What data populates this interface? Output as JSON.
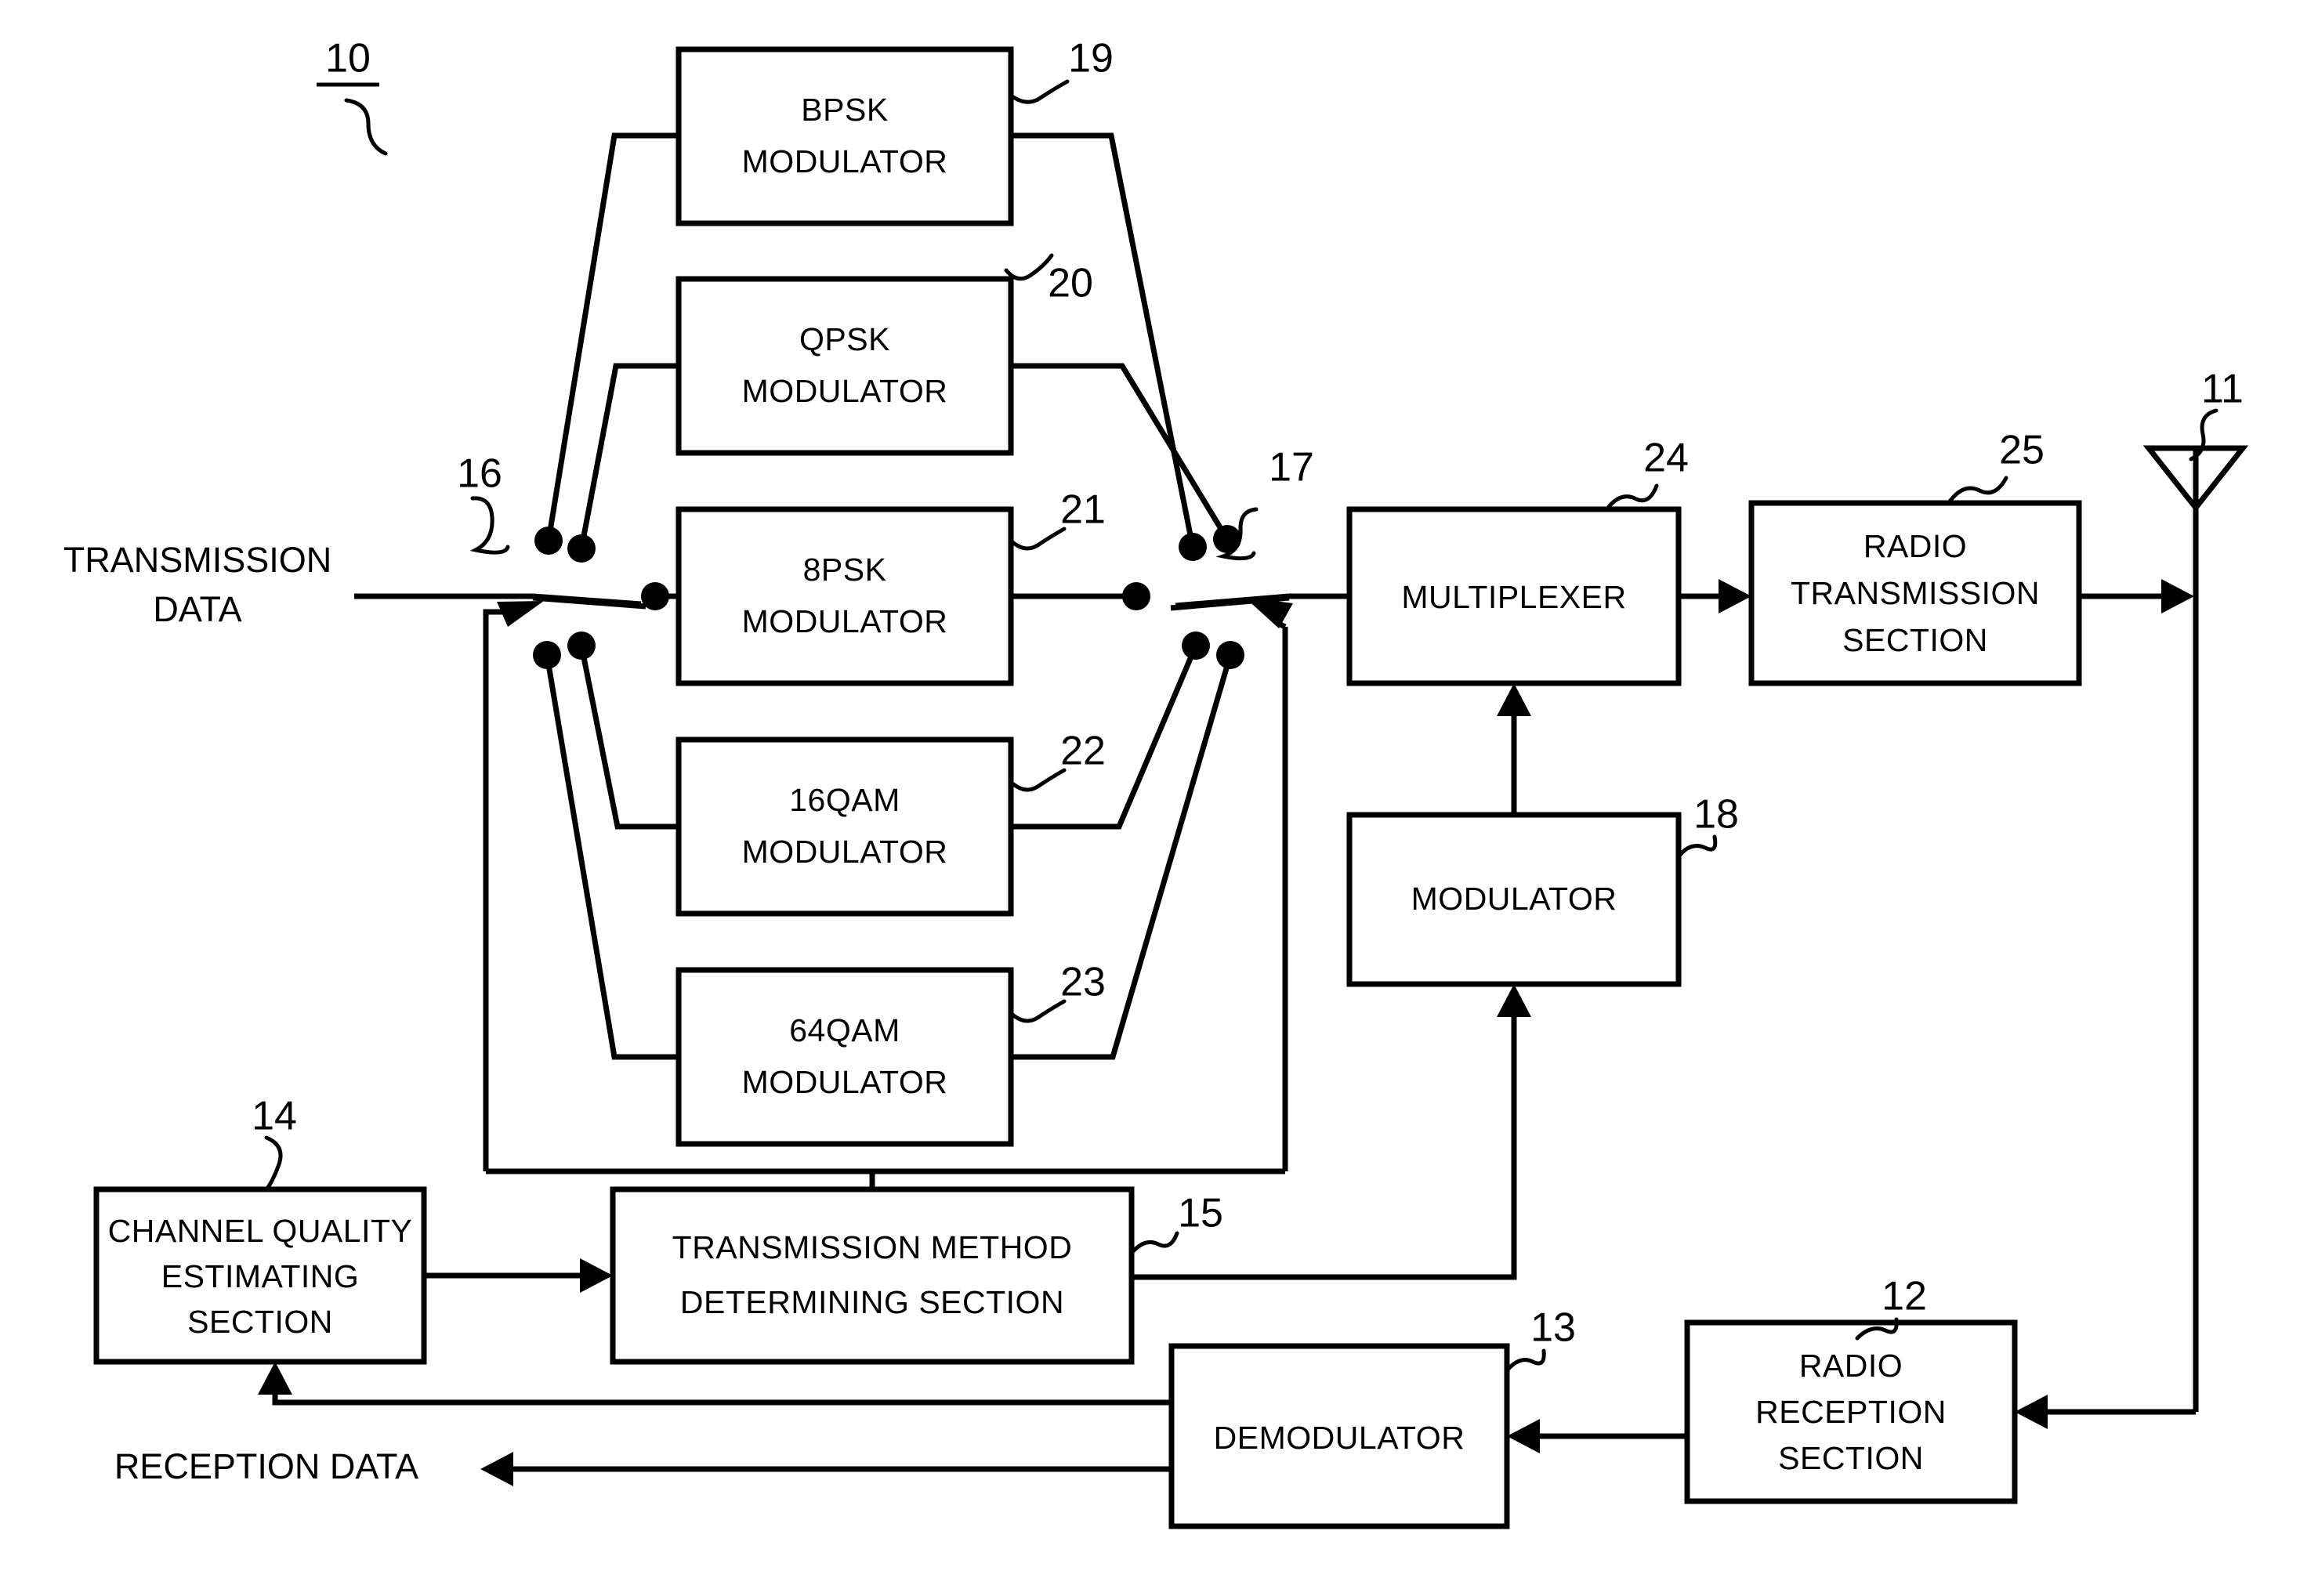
{
  "figure": {
    "system_ref": "10",
    "background_color": "#ffffff",
    "line_color": "#000000"
  },
  "io_labels": {
    "transmission_data_line1": "TRANSMISSION",
    "transmission_data_line2": "DATA",
    "reception_data": "RECEPTION DATA"
  },
  "blocks": [
    {
      "id": "bpsk",
      "ref": "19",
      "line1": "BPSK",
      "line2": "MODULATOR"
    },
    {
      "id": "qpsk",
      "ref": "20",
      "line1": "QPSK",
      "line2": "MODULATOR"
    },
    {
      "id": "psk8",
      "ref": "21",
      "line1": "8PSK",
      "line2": "MODULATOR"
    },
    {
      "id": "qam16",
      "ref": "22",
      "line1": "16QAM",
      "line2": "MODULATOR"
    },
    {
      "id": "qam64",
      "ref": "23",
      "line1": "64QAM",
      "line2": "MODULATOR"
    },
    {
      "id": "multiplexer",
      "ref": "24",
      "line1": "MULTIPLEXER",
      "line2": ""
    },
    {
      "id": "radio_tx",
      "ref": "25",
      "line1": "RADIO",
      "line2": "TRANSMISSION",
      "line3": "SECTION"
    },
    {
      "id": "modulator",
      "ref": "18",
      "line1": "MODULATOR",
      "line2": ""
    },
    {
      "id": "chan_qual",
      "ref": "14",
      "line1": "CHANNEL QUALITY",
      "line2": "ESTIMATING",
      "line3": "SECTION"
    },
    {
      "id": "tx_method",
      "ref": "15",
      "line1": "TRANSMISSION METHOD",
      "line2": "DETERMINING SECTION"
    },
    {
      "id": "demodulator",
      "ref": "13",
      "line1": "DEMODULATOR",
      "line2": ""
    },
    {
      "id": "radio_rx",
      "ref": "12",
      "line1": "RADIO",
      "line2": "RECEPTION",
      "line3": "SECTION"
    }
  ],
  "switches": [
    {
      "id": "switch_in",
      "ref": "16"
    },
    {
      "id": "switch_out",
      "ref": "17"
    }
  ],
  "antenna": {
    "ref": "11"
  }
}
